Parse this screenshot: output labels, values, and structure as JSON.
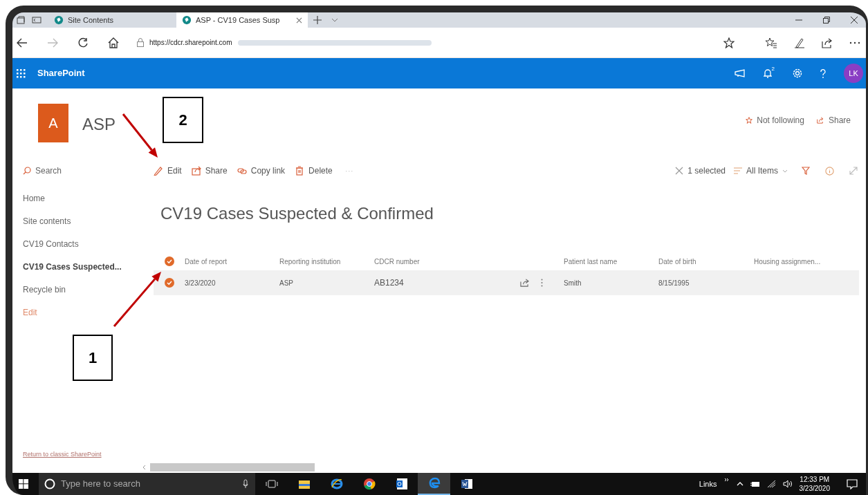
{
  "browser": {
    "tabs": [
      {
        "title": "Site Contents",
        "selected": false
      },
      {
        "title": "ASP - CV19 Cases Susp",
        "selected": true
      }
    ],
    "url_host": "https://cdcr.sharepoint.com"
  },
  "suite_bar": {
    "app_name": "SharePoint",
    "notification_count": "2",
    "avatar_initials": "LK"
  },
  "site": {
    "logo_letter": "A",
    "name": "ASP",
    "actions": [
      {
        "kind": "follow",
        "label": "Not following"
      },
      {
        "kind": "share",
        "label": "Share"
      }
    ]
  },
  "nav": {
    "search_placeholder": "Search",
    "items": [
      {
        "label": "Home",
        "selected": false,
        "kind": "link"
      },
      {
        "label": "Site contents",
        "selected": false,
        "kind": "link"
      },
      {
        "label": "CV19 Contacts",
        "selected": false,
        "kind": "link"
      },
      {
        "label": "CV19 Cases Suspected...",
        "selected": true,
        "kind": "link"
      },
      {
        "label": "Recycle bin",
        "selected": false,
        "kind": "link"
      },
      {
        "label": "Edit",
        "selected": false,
        "kind": "action"
      }
    ]
  },
  "command_bar": {
    "commands": [
      {
        "kind": "edit",
        "label": "Edit"
      },
      {
        "kind": "share",
        "label": "Share"
      },
      {
        "kind": "copy_link",
        "label": "Copy link"
      },
      {
        "kind": "delete",
        "label": "Delete"
      },
      {
        "kind": "more",
        "label": "···"
      }
    ],
    "selection": "1 selected",
    "view": "All Items"
  },
  "list": {
    "title": "CV19 Cases Suspected & Confirmed",
    "all_selected": true,
    "columns": [
      "Date of report",
      "Reporting institution",
      "CDCR number",
      "Patient last name",
      "Date of birth",
      "Housing assignmen..."
    ],
    "rows": [
      {
        "selected": true,
        "cells": [
          "3/23/2020",
          "ASP",
          "AB1234",
          "Smith",
          "8/15/1995"
        ]
      }
    ]
  },
  "footer_link": "Return to classic SharePoint",
  "taskbar": {
    "search_placeholder": "Type here to search",
    "links_label": "Links",
    "time": "12:33 PM",
    "date": "3/23/2020"
  },
  "annotations": [
    {
      "label": "2"
    },
    {
      "label": "1"
    }
  ]
}
